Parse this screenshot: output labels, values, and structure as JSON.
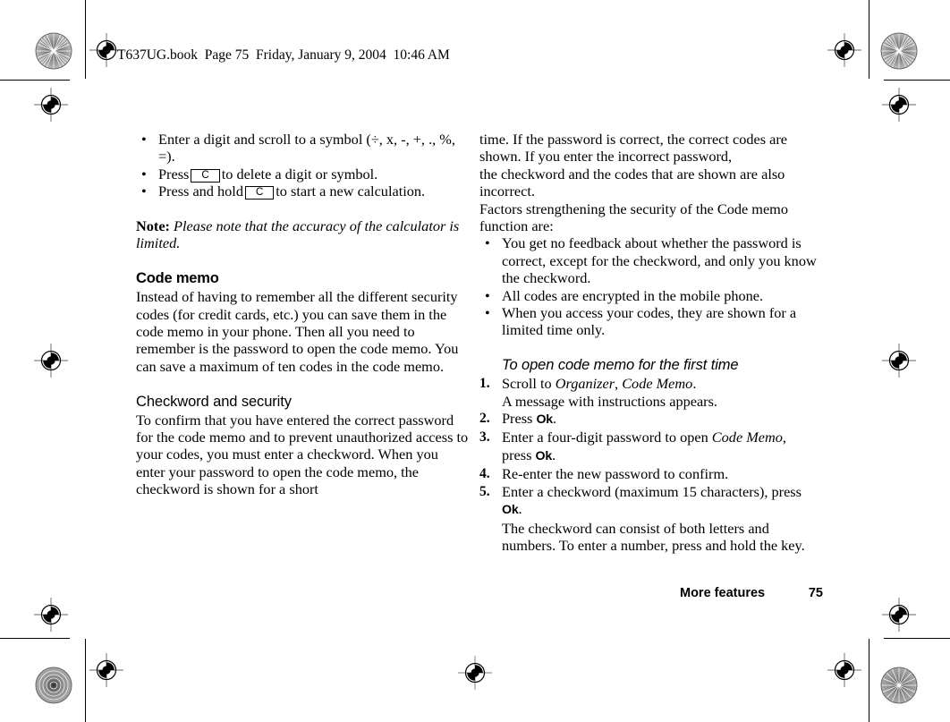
{
  "header_stamp": "T637UG.book  Page 75  Friday, January 9, 2004  10:46 AM",
  "left_column": {
    "bullets_calculator": [
      "Enter a digit and scroll to a symbol (÷, x, -, +, ., %, =).",
      "Press  [C]  to delete a digit or symbol.",
      "Press and hold  [C]  to start a new calculation."
    ],
    "bullet_1_text_a": "Enter a digit and scroll to a symbol (÷, x, -, +, ., %, =).",
    "bullet_2_pre": "Press",
    "bullet_2_key": "C",
    "bullet_2_post": "to delete a digit or symbol.",
    "bullet_3_pre": "Press and hold",
    "bullet_3_key": "C",
    "bullet_3_post": "to start a new calculation.",
    "note_label": "Note:",
    "note_text": "Please note that the accuracy of the calculator is limited.",
    "heading_code_memo": "Code memo",
    "code_memo_body": "Instead of having to remember all the different security codes (for credit cards, etc.) you can save them in the code memo in your phone. Then all you need to remember is the password to open the code memo. You can save a maximum of ten codes in the code memo.",
    "heading_checkword": "Checkword and security",
    "checkword_body": "To confirm that you have entered the correct password for the code memo and to prevent unauthorized access to your codes, you must enter a checkword. When you enter your password to open the code memo, the checkword is shown for a short"
  },
  "right_column": {
    "continuation_para_1": "time. If the password is correct, the correct codes are shown. If you enter the incorrect password,",
    "continuation_para_2": "the checkword and the codes that are shown are also incorrect.",
    "continuation_para_3": "Factors strengthening the security of the Code memo function are:",
    "bullets_security": [
      "You get no feedback about whether the password is correct, except for the checkword, and only you know the checkword.",
      "All codes are encrypted in the mobile phone.",
      "When you access your codes, they are shown for a limited time only."
    ],
    "heading_first_time": "To open code memo for the first time",
    "steps": [
      {
        "num": "1.",
        "pre": "Scroll to ",
        "ital_1": "Organizer",
        "mid": ", ",
        "ital_2": "Code Memo",
        "post": ".",
        "sub": "A message with instructions appears."
      },
      {
        "num": "2.",
        "pre": "Press ",
        "ui": "Ok",
        "post": "."
      },
      {
        "num": "3.",
        "pre": "Enter a four-digit password to open ",
        "ital_1": "Code Memo",
        "post": ",",
        "sub_pre": "press ",
        "sub_ui": "Ok",
        "sub_post": "."
      },
      {
        "num": "4.",
        "pre": "Re-enter the new password to confirm."
      },
      {
        "num": "5.",
        "pre": "Enter a checkword (maximum 15 characters), press",
        "ui": "Ok",
        "post": ".",
        "sub": "The checkword can consist of both letters and numbers. To enter a number, press and hold the key."
      }
    ]
  },
  "footer": {
    "chapter": "More features",
    "page_number": "75"
  },
  "marks": {
    "registration_target": "registration-target-icon",
    "rosette": "rosette-screen-icon"
  }
}
